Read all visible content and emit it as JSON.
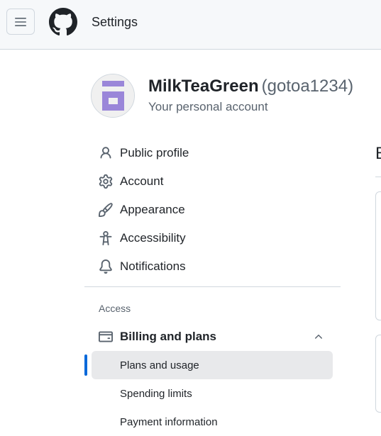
{
  "header": {
    "menu_icon": "hamburger-icon",
    "logo_icon": "github-logo-icon",
    "title": "Settings"
  },
  "account": {
    "username": "MilkTeaGreen",
    "login": "(gotoa1234)",
    "subtitle": "Your personal account",
    "avatar_colors": [
      "#9a86d9",
      "#f0f0f0"
    ]
  },
  "nav": {
    "items": [
      {
        "label": "Public profile",
        "icon": "person-icon"
      },
      {
        "label": "Account",
        "icon": "gear-icon"
      },
      {
        "label": "Appearance",
        "icon": "paintbrush-icon"
      },
      {
        "label": "Accessibility",
        "icon": "accessibility-icon"
      },
      {
        "label": "Notifications",
        "icon": "bell-icon"
      }
    ],
    "access_heading": "Access",
    "billing": {
      "label": "Billing and plans",
      "icon": "credit-card-icon",
      "expanded": true,
      "sub_items": [
        {
          "label": "Plans and usage",
          "active": true
        },
        {
          "label": "Spending limits",
          "active": false
        },
        {
          "label": "Payment information",
          "active": false
        }
      ]
    }
  },
  "right_panel": {
    "heading_fragment": "B"
  },
  "colors": {
    "accent": "#0969da",
    "text": "#1f2328",
    "muted": "#59636e",
    "border": "#d0d7de"
  }
}
